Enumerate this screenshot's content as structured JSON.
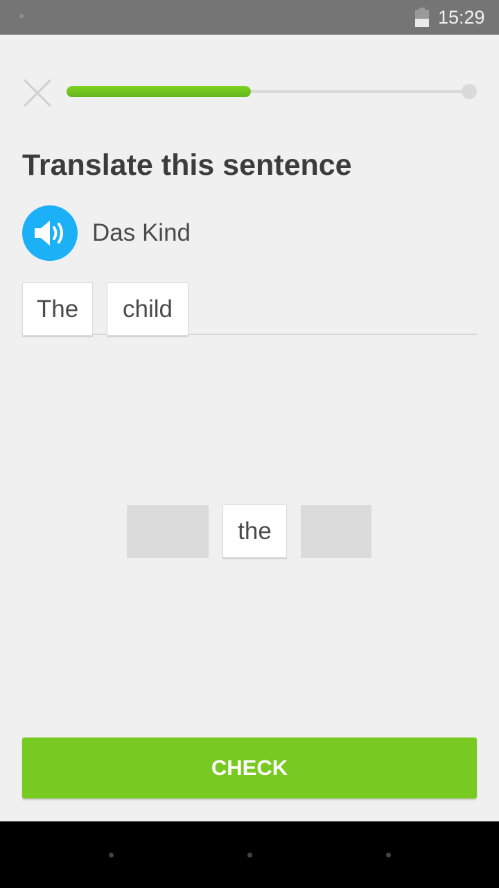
{
  "status_bar": {
    "time": "15:29",
    "icons": [
      "notification-dot-icon",
      "battery-icon"
    ]
  },
  "header": {
    "close_icon": "close-icon",
    "progress": 0.45
  },
  "challenge": {
    "title": "Translate this sentence",
    "speaker_icon": "speaker-icon",
    "source_text": "Das Kind"
  },
  "answer": {
    "selected_words": [
      "The",
      "child"
    ]
  },
  "word_bank": {
    "available_words": [
      "the"
    ]
  },
  "footer": {
    "check_label": "CHECK"
  },
  "colors": {
    "accent_green": "#78c922",
    "speaker_blue": "#1cb0f6",
    "progress_green": "#7ed321"
  },
  "nav_bar": {
    "icons": [
      "back-icon",
      "home-icon",
      "recents-icon"
    ]
  }
}
